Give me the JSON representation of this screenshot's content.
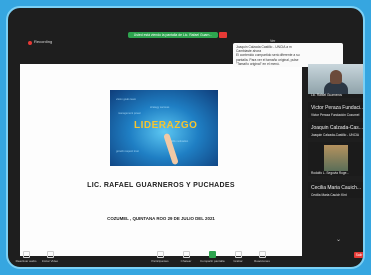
{
  "app": {
    "recording_label": "Recording",
    "share_banner": "Usted está viendo la pantalla de Lic. Rafael Guarn...",
    "view_label": "Ver"
  },
  "notification": {
    "title": "Joaquin Calzada Castillo - UNCIA a m",
    "line2": "Cambiaste ahora",
    "line3": "El contenido compartido será diferente a su",
    "line4": "pantalla. Para ver el tamaño original, pulse",
    "line5": "\"Tamaño original\" en el menú."
  },
  "slide": {
    "image_word": "LIDERAZGO",
    "title": "LIC.  RAFAEL  GUARNEROS Y PUCHADES",
    "footer": "COZUMEL , QUINTANA ROO 29 DE JULIO DEL 2021"
  },
  "participants": [
    {
      "name": "Lic. Rafael Guarneros",
      "type": "video"
    },
    {
      "display": "Victor Peraza Fundaci...",
      "name": "Victor Peraza Fundación Cozumel"
    },
    {
      "display": "Joaquin Calzada-Cas...",
      "name": "Joaquin Calzada-Castillo - UNCIA"
    },
    {
      "name": "Rodolfo L. Segovia Roge...",
      "type": "video"
    },
    {
      "display": "Cecilia Maria Cauich...",
      "name": "Cecilia Maria Cauich Kint"
    }
  ],
  "toolbar": [
    {
      "label": "Reactivar audio",
      "icon": "mic-icon"
    },
    {
      "label": "Iniciar Video",
      "icon": "video-icon"
    },
    {
      "label": "Participantes",
      "icon": "participants-icon"
    },
    {
      "label": "Chatear",
      "icon": "chat-icon"
    },
    {
      "label": "Compartir pantalla",
      "icon": "share-screen-icon"
    },
    {
      "label": "Grabar",
      "icon": "record-icon"
    },
    {
      "label": "Reacciones",
      "icon": "reactions-icon"
    }
  ],
  "exit_label": "Salir",
  "colors": {
    "accent": "#2ea44f",
    "danger": "#e53935",
    "frame": "#7bd0f5"
  }
}
